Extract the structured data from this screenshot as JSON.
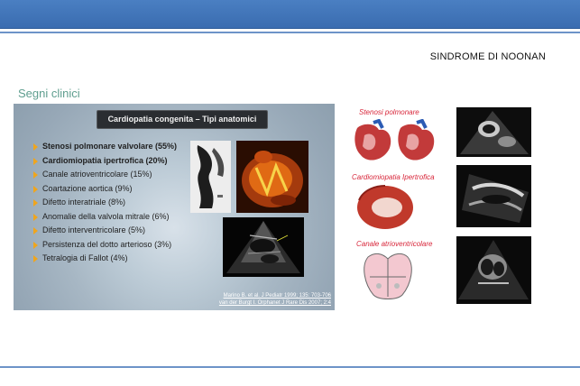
{
  "slide": {
    "deck_title": "SINDROME DI NOONAN",
    "section_heading": "Segni clinici"
  },
  "left_panel": {
    "title": "Cardiopatia congenita – Tipi anatomici",
    "items": [
      {
        "text": "Stenosi polmonare valvolare (55%)",
        "bold": true
      },
      {
        "text": "Cardiomiopatia ipertrofica (20%)",
        "bold": true
      },
      {
        "text": "Canale atrioventricolare (15%)",
        "bold": false
      },
      {
        "text": "Coartazione aortica (9%)",
        "bold": false
      },
      {
        "text": "Difetto interatriale (8%)",
        "bold": false
      },
      {
        "text": "Anomalie della valvola mitrale (6%)",
        "bold": false
      },
      {
        "text": "Difetto interventricolare (5%)",
        "bold": false
      },
      {
        "text": "Persistenza del dotto arterioso (3%)",
        "bold": false
      },
      {
        "text": "Tetralogia di Fallot (4%)",
        "bold": false
      }
    ],
    "citation_line1": "Marino B. et al. J Pediatr 1999; 135: 703-706",
    "citation_line2": "van der Burgt I. Orphanet J Rare Dis 2007; 2:4"
  },
  "right_panel": {
    "pulmonary_label": "Stenosi polmonare",
    "hcm_label": "Cardiomiopatia Ipertrofica",
    "avc_label": "Canale atrioventricolare"
  },
  "colors": {
    "header_bar": "#3a6cb0",
    "rule_lines": "#6d93c8",
    "section_heading": "#5f9e8f",
    "bullet": "#f0a51c",
    "right_labels": "#d8263a"
  }
}
